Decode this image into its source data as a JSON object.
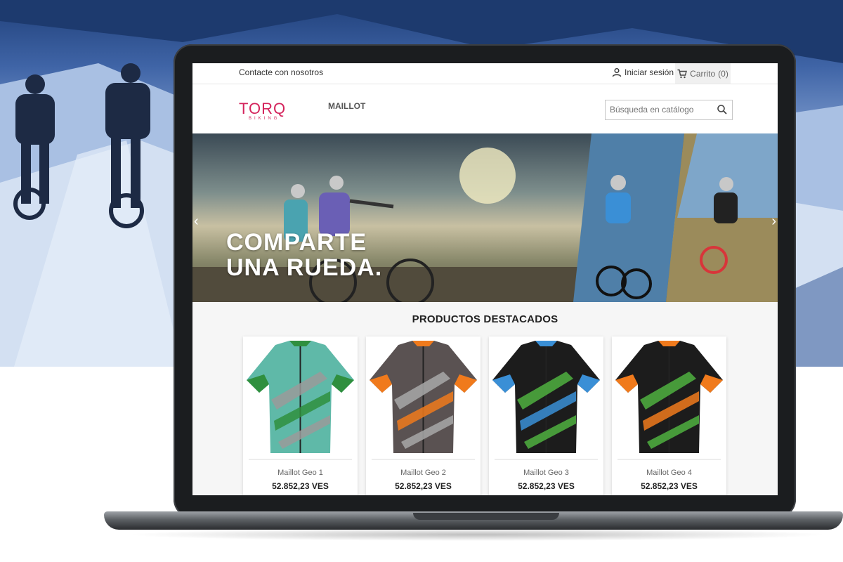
{
  "topbar": {
    "contact_label": "Contacte con nosotros",
    "signin_label": "Iniciar sesión",
    "cart_label": "Carrito",
    "cart_count": "(0)"
  },
  "header": {
    "logo_text": "TORQ",
    "logo_sub": "BIKING",
    "menu_label": "MAILLOT",
    "search_placeholder": "Búsqueda en catálogo"
  },
  "hero": {
    "line1": "COMPARTE",
    "line2": "UNA RUEDA."
  },
  "featured": {
    "title": "PRODUCTOS DESTACADOS",
    "products": [
      {
        "name": "Maillot Geo 1",
        "price": "52.852,23 VES",
        "colors": [
          "#5fb9a8",
          "#2f8f3e",
          "#9a9a9a"
        ]
      },
      {
        "name": "Maillot Geo 2",
        "price": "52.852,23 VES",
        "colors": [
          "#5a5252",
          "#f07a1c",
          "#a8a8a8"
        ]
      },
      {
        "name": "Maillot Geo 3",
        "price": "52.852,23 VES",
        "colors": [
          "#1c1c1c",
          "#3a8fd6",
          "#4fb040"
        ]
      },
      {
        "name": "Maillot Geo 4",
        "price": "52.852,23 VES",
        "colors": [
          "#1c1c1c",
          "#f07a1c",
          "#4fb040"
        ]
      }
    ]
  },
  "theme": {
    "brand": "#d4245c",
    "laptop_frame": "#1b1d1f"
  }
}
